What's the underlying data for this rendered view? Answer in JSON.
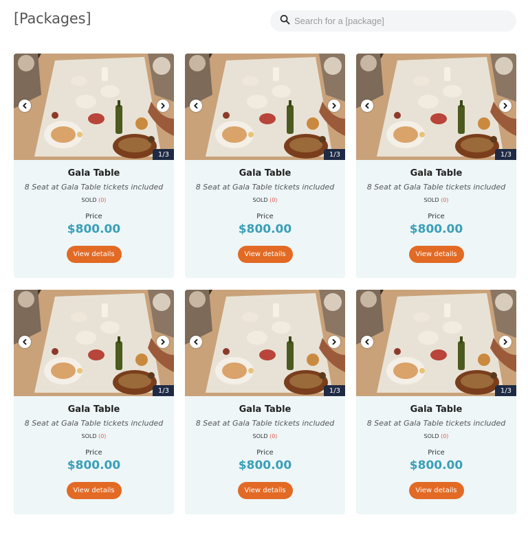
{
  "header": {
    "title": "[Packages]",
    "search_placeholder": "Search for a [package]"
  },
  "icons": {
    "search": "search-icon",
    "prev": "chevron-left-icon",
    "next": "chevron-right-icon"
  },
  "colors": {
    "card_bg": "#eef6f7",
    "price": "#3a9fb8",
    "button": "#e26a24",
    "counter_bg": "#1f2a44",
    "sold_count": "#e05a4f"
  },
  "packages": [
    {
      "name": "Gala Table",
      "description": "8 Seat at Gala Table tickets included",
      "sold_label": "SOLD",
      "sold_count": "(0)",
      "price_label": "Price",
      "price": "$800.00",
      "button_label": "View details",
      "image_counter": "1/3"
    },
    {
      "name": "Gala Table",
      "description": "8 Seat at Gala Table tickets included",
      "sold_label": "SOLD",
      "sold_count": "(0)",
      "price_label": "Price",
      "price": "$800.00",
      "button_label": "View details",
      "image_counter": "1/3"
    },
    {
      "name": "Gala Table",
      "description": "8 Seat at Gala Table tickets included",
      "sold_label": "SOLD",
      "sold_count": "(0)",
      "price_label": "Price",
      "price": "$800.00",
      "button_label": "View details",
      "image_counter": "1/3"
    },
    {
      "name": "Gala Table",
      "description": "8 Seat at Gala Table tickets included",
      "sold_label": "SOLD",
      "sold_count": "(0)",
      "price_label": "Price",
      "price": "$800.00",
      "button_label": "View details",
      "image_counter": "1/3"
    },
    {
      "name": "Gala Table",
      "description": "8 Seat at Gala Table tickets included",
      "sold_label": "SOLD",
      "sold_count": "(0)",
      "price_label": "Price",
      "price": "$800.00",
      "button_label": "View details",
      "image_counter": "1/3"
    },
    {
      "name": "Gala Table",
      "description": "8 Seat at Gala Table tickets included",
      "sold_label": "SOLD",
      "sold_count": "(0)",
      "price_label": "Price",
      "price": "$800.00",
      "button_label": "View details",
      "image_counter": "1/3"
    }
  ]
}
